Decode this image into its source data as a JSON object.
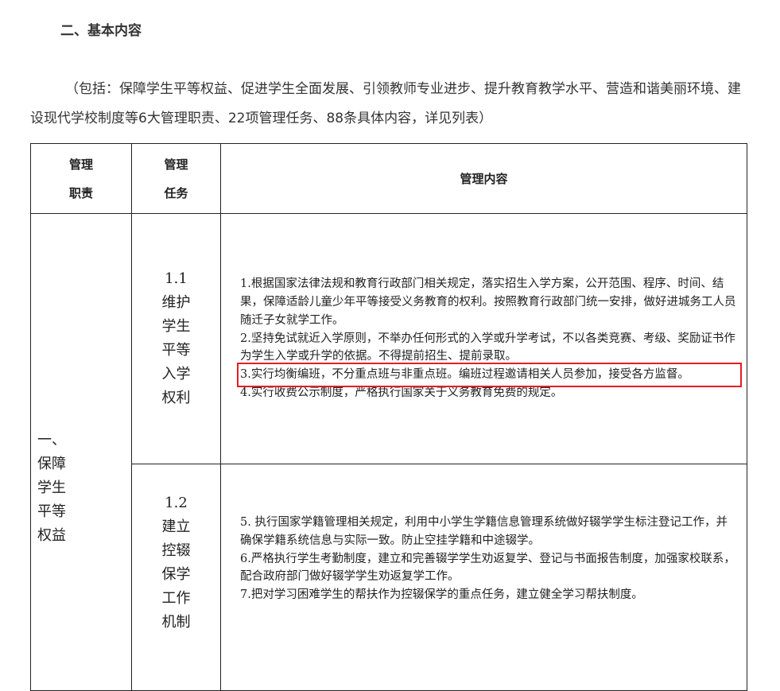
{
  "heading": "二、基本内容",
  "intro": "（包括：保障学生平等权益、促进学生全面发展、引领教师专业进步、提升教育教学水平、营造和谐美丽环境、建设现代学校制度等6大管理职责、22项管理任务、88条具体内容，详见列表）",
  "table": {
    "headers": {
      "duty": [
        "管理",
        "职责"
      ],
      "task": [
        "管理",
        "任务"
      ],
      "content": "管理内容"
    },
    "duty": [
      "一、",
      "保障",
      "学生",
      "平等",
      "权益"
    ],
    "tasks": [
      {
        "lines": [
          "1.1",
          "维护",
          "学生",
          "平等",
          "入学",
          "权利"
        ],
        "items": [
          "1.根据国家法律法规和教育行政部门相关规定，落实招生入学方案，公开范围、程序、时间、结果，保障适龄儿童少年平等接受义务教育的权利。按照教育行政部门统一安排，做好进城务工人员随迁子女就学工作。",
          "2.坚持免试就近入学原则，不举办任何形式的入学或升学考试，不以各类竞赛、考级、奖励证书作为学生入学或升学的依据。不得提前招生、提前录取。",
          "3.实行均衡编班，不分重点班与非重点班。编班过程邀请相关人员参加，接受各方监督。",
          "4.实行收费公示制度，严格执行国家关于义务教育免费的规定。"
        ]
      },
      {
        "lines": [
          "1.2",
          "建立",
          "控辍",
          "保学",
          "工作",
          "机制"
        ],
        "items": [
          "5. 执行国家学籍管理相关规定，利用中小学生学籍信息管理系统做好辍学学生标注登记工作，并确保学籍系统信息与实际一致。防止空挂学籍和中途辍学。",
          "6.严格执行学生考勤制度，建立和完善辍学学生劝返复学、登记与书面报告制度，加强家校联系，配合政府部门做好辍学学生劝返复学工作。",
          "7.把对学习困难学生的帮扶作为控辍保学的重点任务，建立健全学习帮扶制度。"
        ]
      }
    ]
  },
  "colors": {
    "highlight": "#e21e23",
    "border": "#222222",
    "text": "#333333"
  }
}
